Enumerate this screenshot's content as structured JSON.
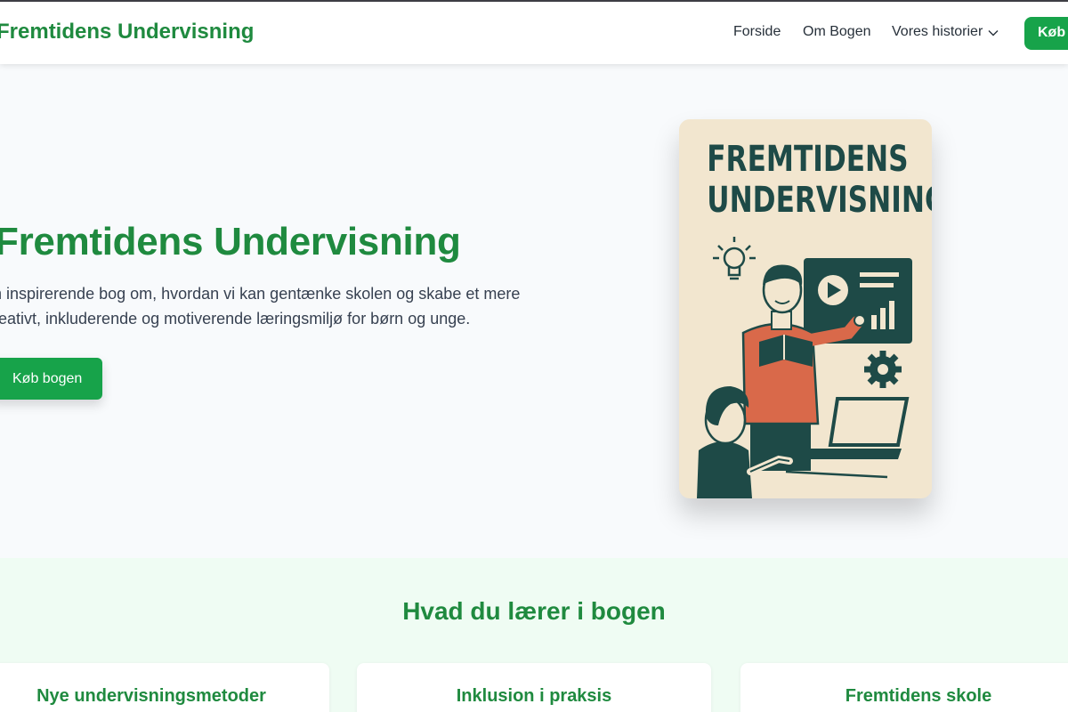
{
  "brand": {
    "name": "Fremtidens Undervisning"
  },
  "nav": {
    "items": [
      "Forside",
      "Om Bogen",
      "Vores historier"
    ],
    "buy_label": "Køb"
  },
  "hero": {
    "title": "Fremtidens Undervisning",
    "text": "n inspirerende bog om, hvordan vi kan gentænke skolen og skabe et mere reativt, inkluderende og motiverende læringsmiljø for børn og unge.",
    "button_label": "Køb bogen"
  },
  "cover": {
    "title_line1": "FREMTIDENS",
    "title_line2": "UNDERVISNING"
  },
  "features": {
    "title": "Hvad du lærer i bogen",
    "cards": [
      {
        "title": "Nye undervisningsmetoder"
      },
      {
        "title": "Inklusion i praksis"
      },
      {
        "title": "Fremtidens skole"
      }
    ]
  },
  "colors": {
    "brand_green": "#1f8a3f",
    "button_green": "#17a34a",
    "cover_bg": "#f2e6cf",
    "cover_ink": "#1e4a47",
    "cover_accent": "#d9694a",
    "features_bg": "#effcf3"
  }
}
